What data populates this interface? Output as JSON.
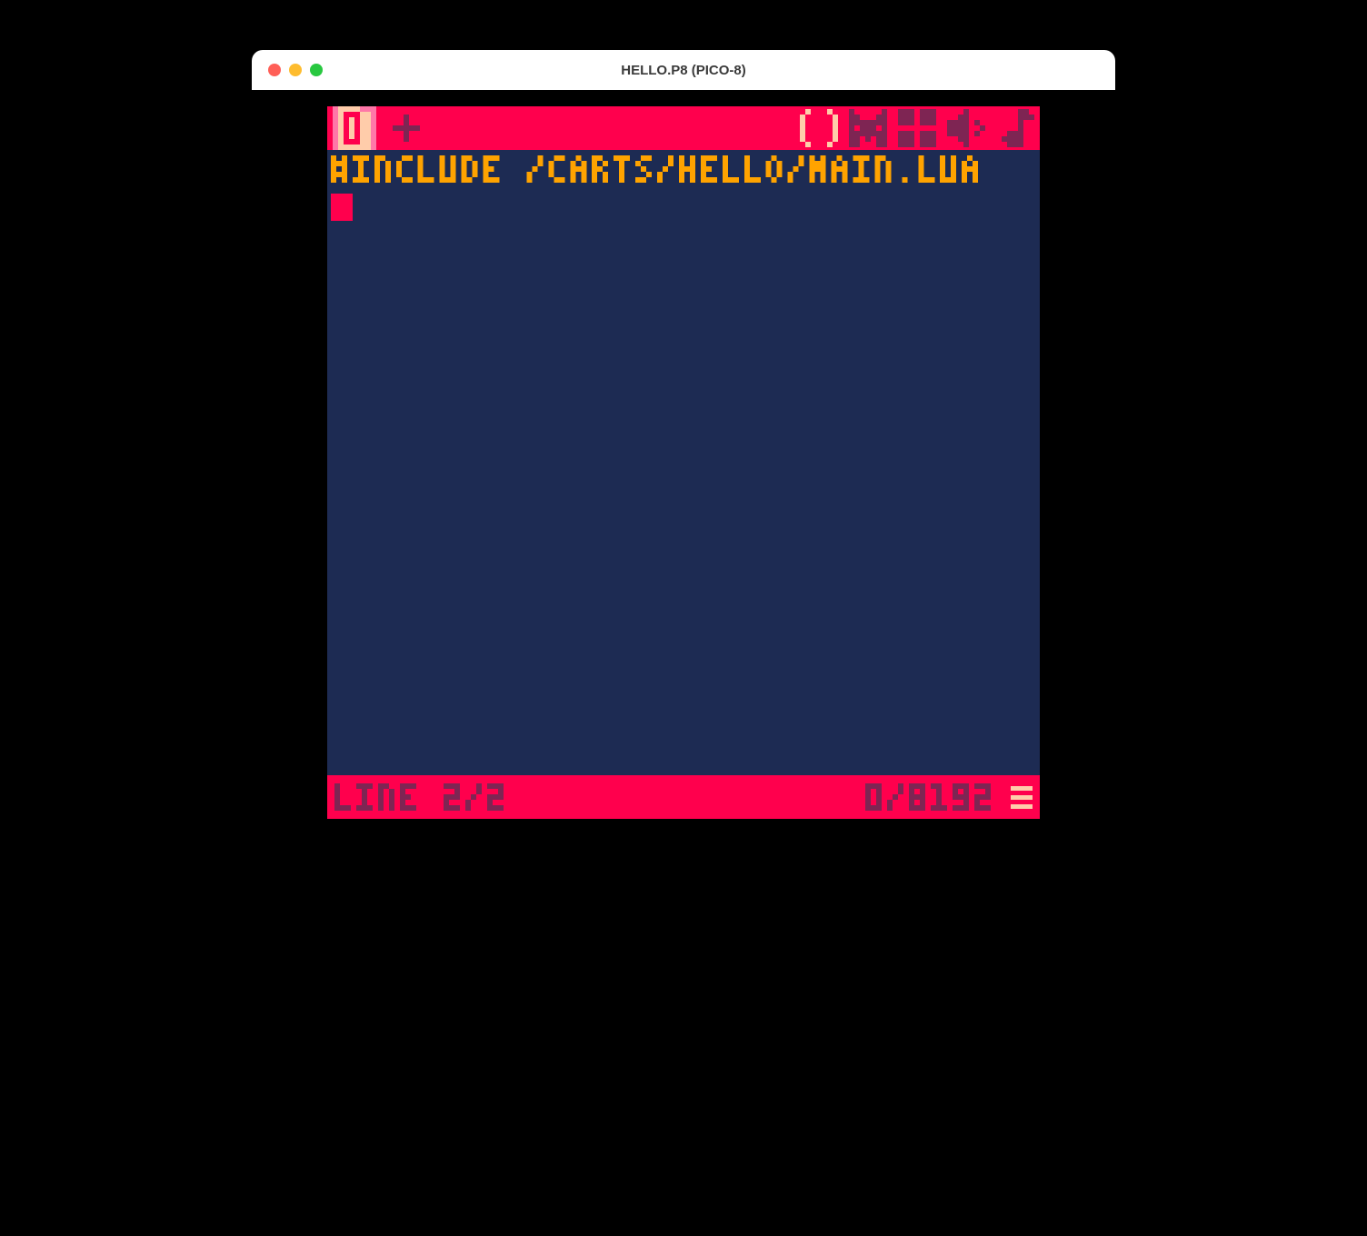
{
  "window": {
    "title": "HELLO.P8 (PICO-8)"
  },
  "toolbar": {
    "tab_number": "0",
    "add_tab_label": "+",
    "tools": {
      "code": "code-editor-icon",
      "sprite": "sprite-editor-icon",
      "map": "map-editor-icon",
      "sfx": "sfx-editor-icon",
      "music": "music-editor-icon"
    }
  },
  "editor": {
    "code_line_1": "#INCLUDE /CARTS/HELLO/MAIN.LUA",
    "current_line": 2,
    "total_lines": 2
  },
  "statusbar": {
    "line_text": "LINE 2/2",
    "token_text": "0/8192"
  },
  "colors": {
    "red": "#ff004d",
    "dark_purple": "#7e2553",
    "peach": "#ffccaa",
    "orange": "#ffa300",
    "dark_blue": "#1d2b53",
    "pink": "#ff77a8"
  }
}
